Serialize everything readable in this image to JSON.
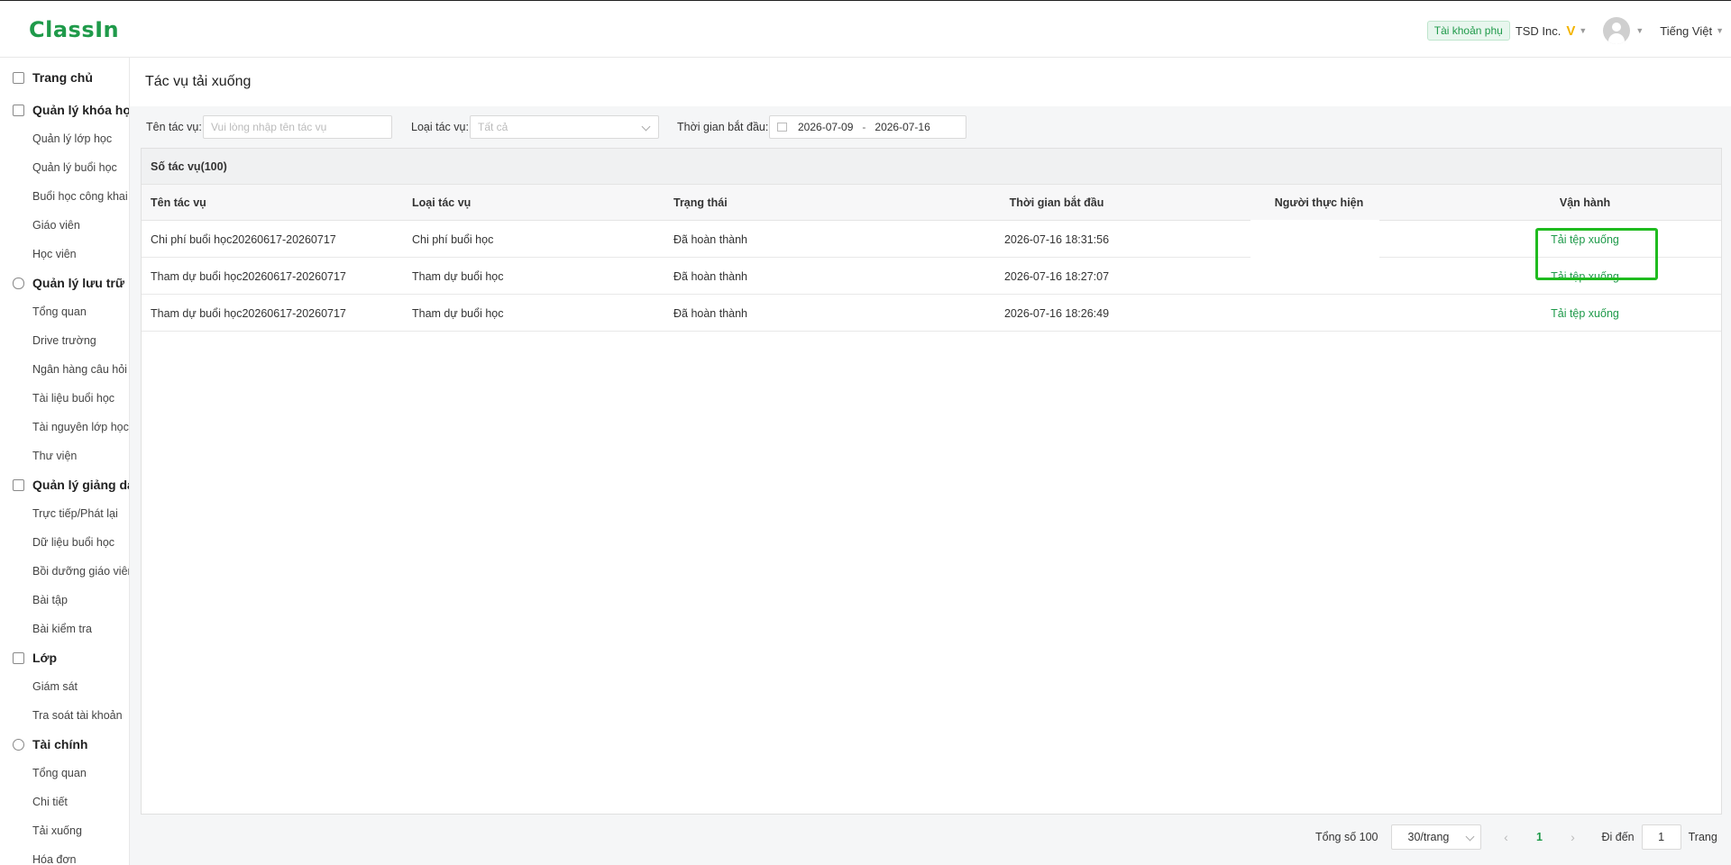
{
  "header": {
    "logo": "ClassIn",
    "sub_account_badge": "Tài khoản phụ",
    "org_name": "TSD Inc.",
    "vip_mark": "V",
    "language": "Tiếng Việt"
  },
  "sidebar": {
    "groups": [
      {
        "label": "Trang chủ",
        "icon": "home-icon",
        "items": []
      },
      {
        "label": "Quản lý khóa học",
        "icon": "course-icon",
        "items": [
          "Quản lý lớp học",
          "Quản lý buổi học",
          "Buổi học công khai",
          "Giáo viên",
          "Học viên"
        ]
      },
      {
        "label": "Quản lý lưu trữ",
        "icon": "cloud-icon",
        "items": [
          "Tổng quan",
          "Drive trường",
          "Ngân hàng câu hỏi",
          "Tài liệu buổi học",
          "Tài nguyên lớp học",
          "Thư viện"
        ]
      },
      {
        "label": "Quản lý giảng dạy",
        "icon": "teaching-icon",
        "items": [
          "Trực tiếp/Phát lại",
          "Dữ liệu buổi học",
          "Bồi dưỡng giáo viên",
          "Bài tập",
          "Bài kiểm tra"
        ]
      },
      {
        "label": "Lớp",
        "icon": "class-icon",
        "items": [
          "Giám sát",
          "Tra soát tài khoản"
        ]
      },
      {
        "label": "Tài chính",
        "icon": "finance-icon",
        "items": [
          "Tổng quan",
          "Chi tiết",
          "Tải xuống",
          "Hóa đơn"
        ]
      }
    ]
  },
  "page": {
    "title": "Tác vụ tải xuống"
  },
  "filters": {
    "task_name_label": "Tên tác vụ:",
    "task_name_placeholder": "Vui lòng nhập tên tác vụ",
    "task_type_label": "Loại tác vụ:",
    "task_type_value": "Tất cả",
    "start_time_label": "Thời gian bắt đầu:",
    "date_from": "2026-07-09",
    "date_separator": "-",
    "date_to": "2026-07-16"
  },
  "table": {
    "count_label": "Số tác vụ(100)",
    "columns": [
      "Tên tác vụ",
      "Loại tác vụ",
      "Trạng thái",
      "Thời gian bắt đầu",
      "Người thực hiện",
      "Vận hành"
    ],
    "rows": [
      {
        "name": "Chi phí buổi học20260617-20260717",
        "type": "Chi phí buổi học",
        "status": "Đã hoàn thành",
        "start": "2026-07-16 18:31:56",
        "action": "Tải tệp xuống"
      },
      {
        "name": "Tham dự buổi học20260617-20260717",
        "type": "Tham dự buổi học",
        "status": "Đã hoàn thành",
        "start": "2026-07-16 18:27:07",
        "action": "Tải tệp xuống"
      },
      {
        "name": "Tham dự buổi học20260617-20260717",
        "type": "Tham dự buổi học",
        "status": "Đã hoàn thành",
        "start": "2026-07-16 18:26:49",
        "action": "Tải tệp xuống"
      }
    ]
  },
  "pagination": {
    "total_label": "Tổng số 100",
    "page_size": "30/trang",
    "current_page": "1",
    "goto_label": "Đi đến",
    "goto_value": "1",
    "page_suffix": "Trang"
  },
  "colors": {
    "brand": "#1f9a4a",
    "highlight": "#1fbb1f"
  }
}
